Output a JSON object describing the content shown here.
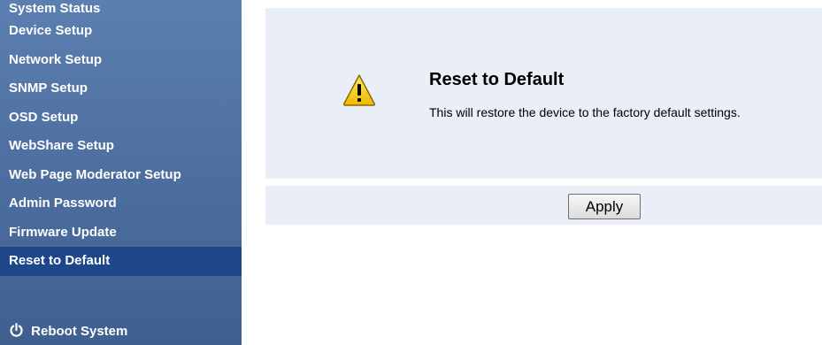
{
  "sidebar": {
    "items": [
      {
        "label": "System Status"
      },
      {
        "label": "Device Setup"
      },
      {
        "label": "Network Setup"
      },
      {
        "label": "SNMP Setup"
      },
      {
        "label": "OSD Setup"
      },
      {
        "label": "WebShare Setup"
      },
      {
        "label": "Web Page Moderator Setup"
      },
      {
        "label": "Admin Password"
      },
      {
        "label": "Firmware Update"
      },
      {
        "label": "Reset to Default",
        "active": true
      }
    ],
    "reboot_label": "Reboot System",
    "reboot_icon": "power-icon"
  },
  "main": {
    "title": "Reset to Default",
    "message": "This will restore the device to the factory default settings.",
    "icon": "warning-icon",
    "apply_label": "Apply"
  },
  "colors": {
    "sidebar_top": "#5b7fb0",
    "sidebar_bottom": "#3f5f8f",
    "sidebar_active": "#1e468a",
    "content_bg": "#eaeef7",
    "warning_yellow": "#f5c400"
  }
}
